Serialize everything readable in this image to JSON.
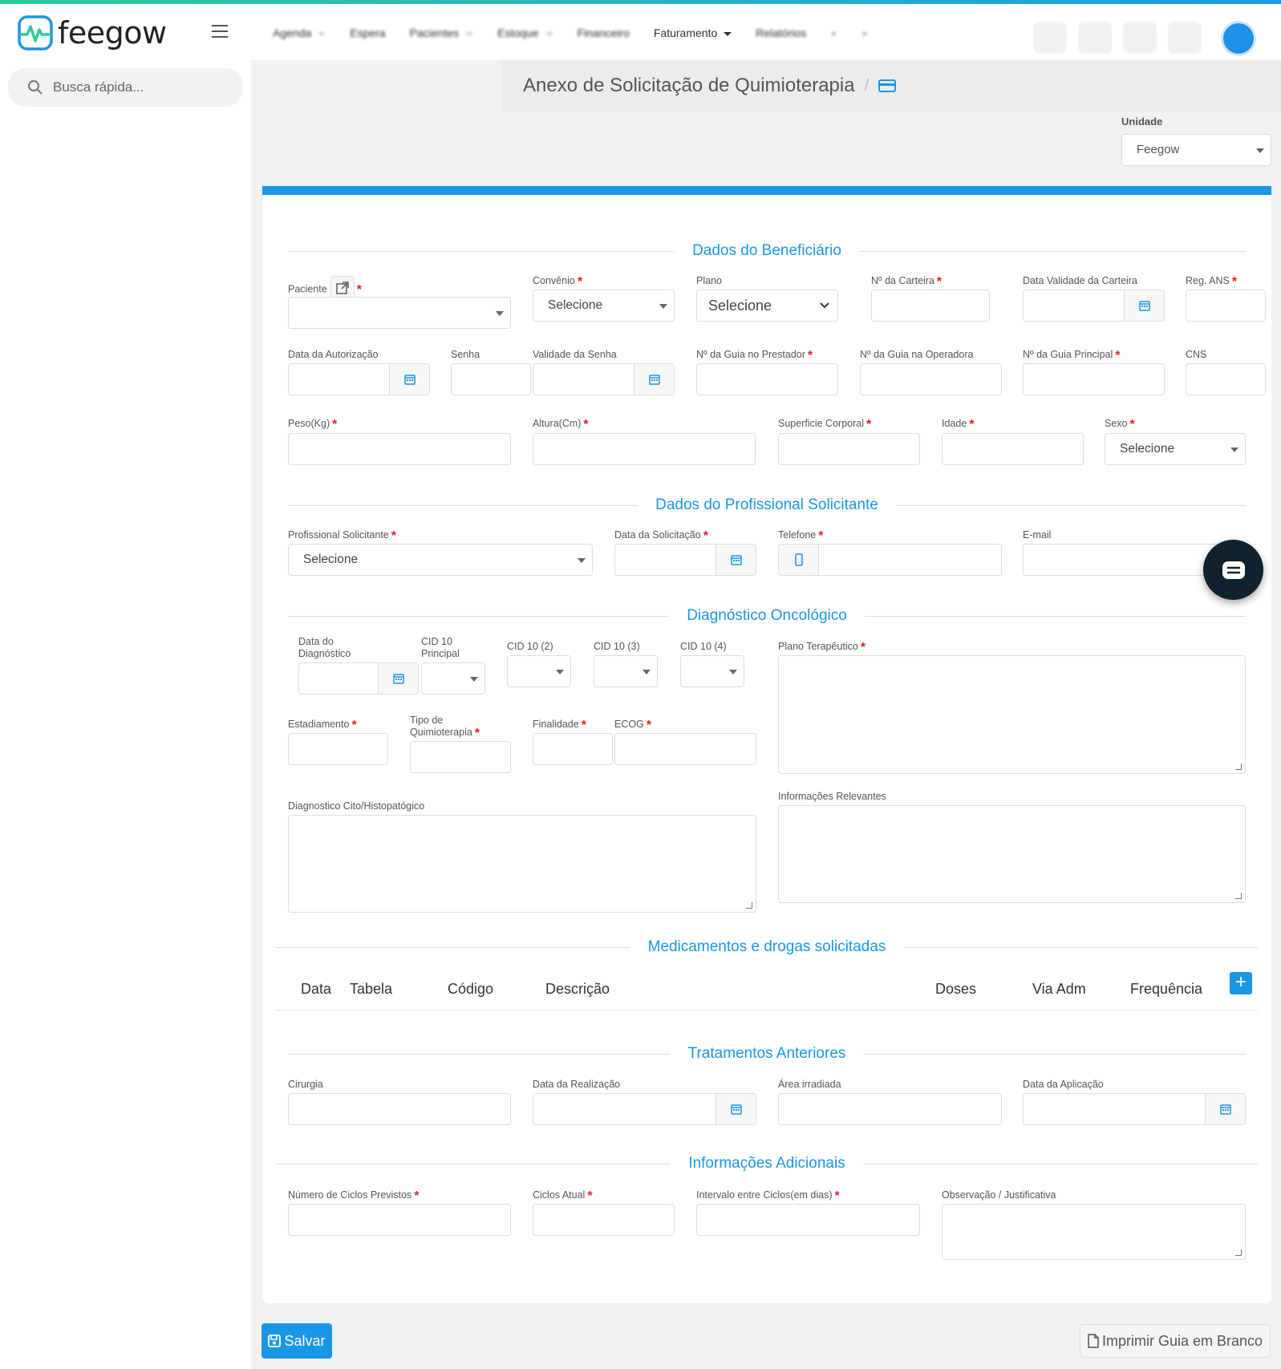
{
  "app": {
    "logo_text": "feegow",
    "brand_color": "#1a96e6"
  },
  "nav": {
    "items": [
      {
        "label": "Agenda",
        "dropdown": true,
        "blurred": true
      },
      {
        "label": "Espera",
        "dropdown": false,
        "blurred": true
      },
      {
        "label": "Pacientes",
        "dropdown": true,
        "blurred": true
      },
      {
        "label": "Estoque",
        "dropdown": true,
        "blurred": true
      },
      {
        "label": "Financeiro",
        "dropdown": false,
        "blurred": true
      },
      {
        "label": "Faturamento",
        "dropdown": true,
        "blurred": false
      },
      {
        "label": "Relatórios",
        "dropdown": false,
        "blurred": true
      }
    ]
  },
  "search": {
    "placeholder": "Busca rápida..."
  },
  "page": {
    "title": "Anexo de Solicitação de Quimioterapia",
    "separator": "/"
  },
  "unit": {
    "label": "Unidade",
    "value": "Feegow"
  },
  "sections": {
    "beneficiario": "Dados do Beneficiário",
    "profissional": "Dados do Profissional Solicitante",
    "diagnostico": "Diagnóstico Oncológico",
    "medicamentos": "Medicamentos e drogas solicitadas",
    "tratamentos": "Tratamentos Anteriores",
    "adicionais": "Informações Adicionais"
  },
  "fields": {
    "paciente": "Paciente",
    "convenio": "Convênio",
    "convenio_value": "Selecione",
    "plano": "Plano",
    "plano_value": "Selecione",
    "carteira": "Nº da Carteira",
    "validade_carteira": "Data Validade da Carteira",
    "reg_ans": "Reg. ANS",
    "data_autorizacao": "Data da Autorização",
    "senha": "Senha",
    "validade_senha": "Validade da Senha",
    "guia_prestador": "Nº da Guia no Prestador",
    "guia_operadora": "Nº da Guia na Operadora",
    "guia_principal": "Nº da Guia Principal",
    "cns": "CNS",
    "peso": "Peso(Kg)",
    "altura": "Altura(Cm)",
    "superficie": "Superficie Corporal",
    "idade": "Idade",
    "sexo": "Sexo",
    "sexo_value": "Selecione",
    "profissional": "Profissional Solicitante",
    "profissional_value": "Selecione",
    "data_solicitacao": "Data da Solicitação",
    "telefone": "Telefone",
    "email": "E-mail",
    "data_diag_1": "Data do",
    "data_diag_2": "Diagnóstico",
    "cid_principal_1": "CID 10",
    "cid_principal_2": "Principal",
    "cid2": "CID 10 (2)",
    "cid3": "CID 10 (3)",
    "cid4": "CID 10 (4)",
    "plano_terapeutico": "Plano Terapêutico",
    "estadiamento": "Estadiamento",
    "tipo_quimio_1": "Tipo de",
    "tipo_quimio_2": "Quimioterapia",
    "finalidade": "Finalidade",
    "ecog": "ECOG",
    "diag_cito": "Diagnostico Cito/Histopatógico",
    "info_relevantes": "Informações Relevantes",
    "cirurgia": "Cirurgia",
    "data_realizacao": "Data da Realização",
    "area_irradiada": "Área irradiada",
    "data_aplicacao": "Data da Aplicação",
    "ciclos_previstos": "Número de Ciclos Previstos",
    "ciclos_atual": "Ciclos Atual",
    "intervalo": "Intervalo entre Ciclos(em dias)",
    "observacao": "Observação / Justificativa"
  },
  "med_table": {
    "headers": [
      "Data",
      "Tabela",
      "Código",
      "Descrição",
      "Doses",
      "Via Adm",
      "Frequência"
    ],
    "add_label": "+"
  },
  "actions": {
    "save": "Salvar",
    "print": "Imprimir Guia em Branco"
  }
}
